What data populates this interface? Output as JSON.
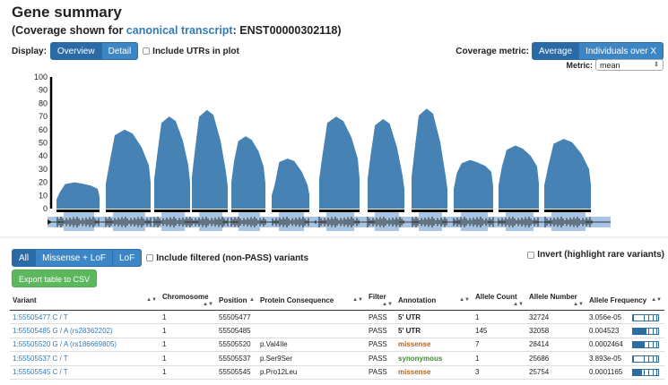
{
  "header": {
    "title": "Gene summary",
    "subtitle_prefix": "(Coverage shown for ",
    "subtitle_link": "canonical transcript",
    "subtitle_suffix": ": ENST00000302118)"
  },
  "display": {
    "label": "Display:",
    "overview": "Overview",
    "detail": "Detail",
    "include_utrs": "Include UTRs in plot"
  },
  "coverage": {
    "label": "Coverage metric:",
    "average": "Average",
    "individuals": "Individuals over X",
    "metric_label": "Metric:",
    "metric_value": "mean"
  },
  "chart_data": {
    "type": "area",
    "ylim": [
      0,
      100
    ],
    "yticks": [
      "100",
      "90",
      "80",
      "70",
      "60",
      "50",
      "40",
      "30",
      "20",
      "10",
      "0"
    ],
    "exons": [
      {
        "peak": 20,
        "left": 14,
        "right": 15
      },
      {
        "peak": 60,
        "left": 38,
        "right": 33
      },
      {
        "peak": 70,
        "left": 45,
        "right": 33
      },
      {
        "peak": 75,
        "left": 48,
        "right": 28
      },
      {
        "peak": 55,
        "left": 40,
        "right": 32
      },
      {
        "peak": 38,
        "left": 20,
        "right": 18
      },
      {
        "peak": 70,
        "left": 45,
        "right": 38
      },
      {
        "peak": 68,
        "left": 45,
        "right": 25
      },
      {
        "peak": 76,
        "left": 48,
        "right": 25
      },
      {
        "peak": 37,
        "left": 30,
        "right": 28
      },
      {
        "peak": 48,
        "left": 35,
        "right": 32
      },
      {
        "peak": 53,
        "left": 35,
        "right": 30
      }
    ],
    "colors": {
      "area": "#4682b4",
      "track": "#a7c4e2"
    }
  },
  "filters": {
    "all": "All",
    "missense_lof": "Missense + LoF",
    "lof": "LoF",
    "include_filtered": "Include filtered (non-PASS) variants",
    "invert": "Invert (highlight rare variants)",
    "export": "Export table to CSV"
  },
  "table": {
    "headers": [
      "Variant",
      "Chromosome",
      "Position",
      "Protein Consequence",
      "Filter",
      "Annotation",
      "Allele Count",
      "Allele Number",
      "Allele Frequency"
    ],
    "rows": [
      {
        "variant": "1:55505477 C / T",
        "chrom": "1",
        "pos": "55505477",
        "protein": "",
        "filter": "PASS",
        "annotation": "5' UTR",
        "ann_color": "#222",
        "ac": "1",
        "an": "32724",
        "af": "3.056e-05",
        "bar": 0.04
      },
      {
        "variant": "1:55505485 G / A (rs28362202)",
        "chrom": "1",
        "pos": "55505485",
        "protein": "",
        "filter": "PASS",
        "annotation": "5' UTR",
        "ann_color": "#222",
        "ac": "145",
        "an": "32058",
        "af": "0.004523",
        "bar": 0.55
      },
      {
        "variant": "1:55505520 G / A (rs186669805)",
        "chrom": "1",
        "pos": "55505520",
        "protein": "p.Val4Ile",
        "filter": "PASS",
        "annotation": "missense",
        "ann_color": "#b5651d",
        "ac": "7",
        "an": "28414",
        "af": "0.0002464",
        "bar": 0.45
      },
      {
        "variant": "1:55505537 C / T",
        "chrom": "1",
        "pos": "55505537",
        "protein": "p.Ser9Ser",
        "filter": "PASS",
        "annotation": "synonymous",
        "ann_color": "#3c8d2f",
        "ac": "1",
        "an": "25686",
        "af": "3.893e-05",
        "bar": 0.05
      },
      {
        "variant": "1:55505545 C / T",
        "chrom": "1",
        "pos": "55505545",
        "protein": "p.Pro12Leu",
        "filter": "PASS",
        "annotation": "missense",
        "ann_color": "#b5651d",
        "ac": "3",
        "an": "25754",
        "af": "0.0001165",
        "bar": 0.35
      }
    ]
  }
}
